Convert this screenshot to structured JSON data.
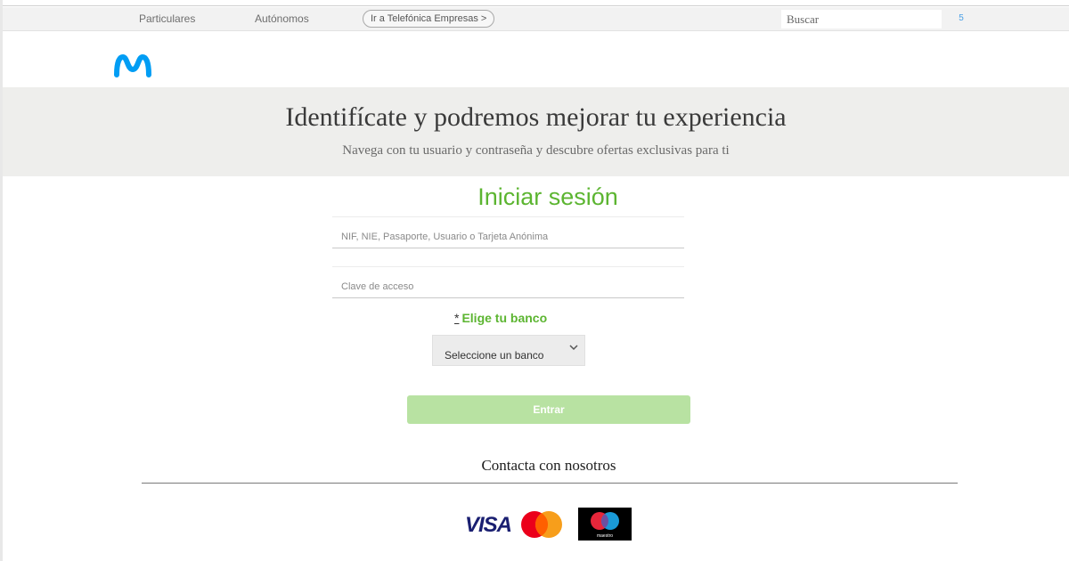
{
  "topbar": {
    "tabs": [
      "Particulares",
      "Autónomos"
    ],
    "empresas_link": "Ir a Telefónica Empresas >",
    "search_placeholder": "Buscar",
    "search_button": "5"
  },
  "brand": {
    "logo": "movistar-m-icon",
    "color": "#019df4"
  },
  "hero": {
    "title": "Identifícate y podremos mejorar tu experiencia",
    "subtitle": "Navega con tu usuario y contraseña y descubre ofertas exclusivas para ti"
  },
  "login": {
    "title": "Iniciar sesión",
    "user_placeholder": "NIF, NIE, Pasaporte, Usuario o Tarjeta Anónima",
    "password_placeholder": "Clave de acceso",
    "bank_required_mark": "*",
    "bank_label": "Elige tu banco",
    "bank_select_value": "Seleccione un banco",
    "submit_label": "Entrar",
    "accent_color": "#5cb531"
  },
  "footer": {
    "contact": "Contacta con nosotros",
    "payment_logos": [
      "visa-logo",
      "mastercard-logo",
      "maestro-logo"
    ],
    "visa_text": "VISA",
    "maestro_text": "maestro"
  }
}
